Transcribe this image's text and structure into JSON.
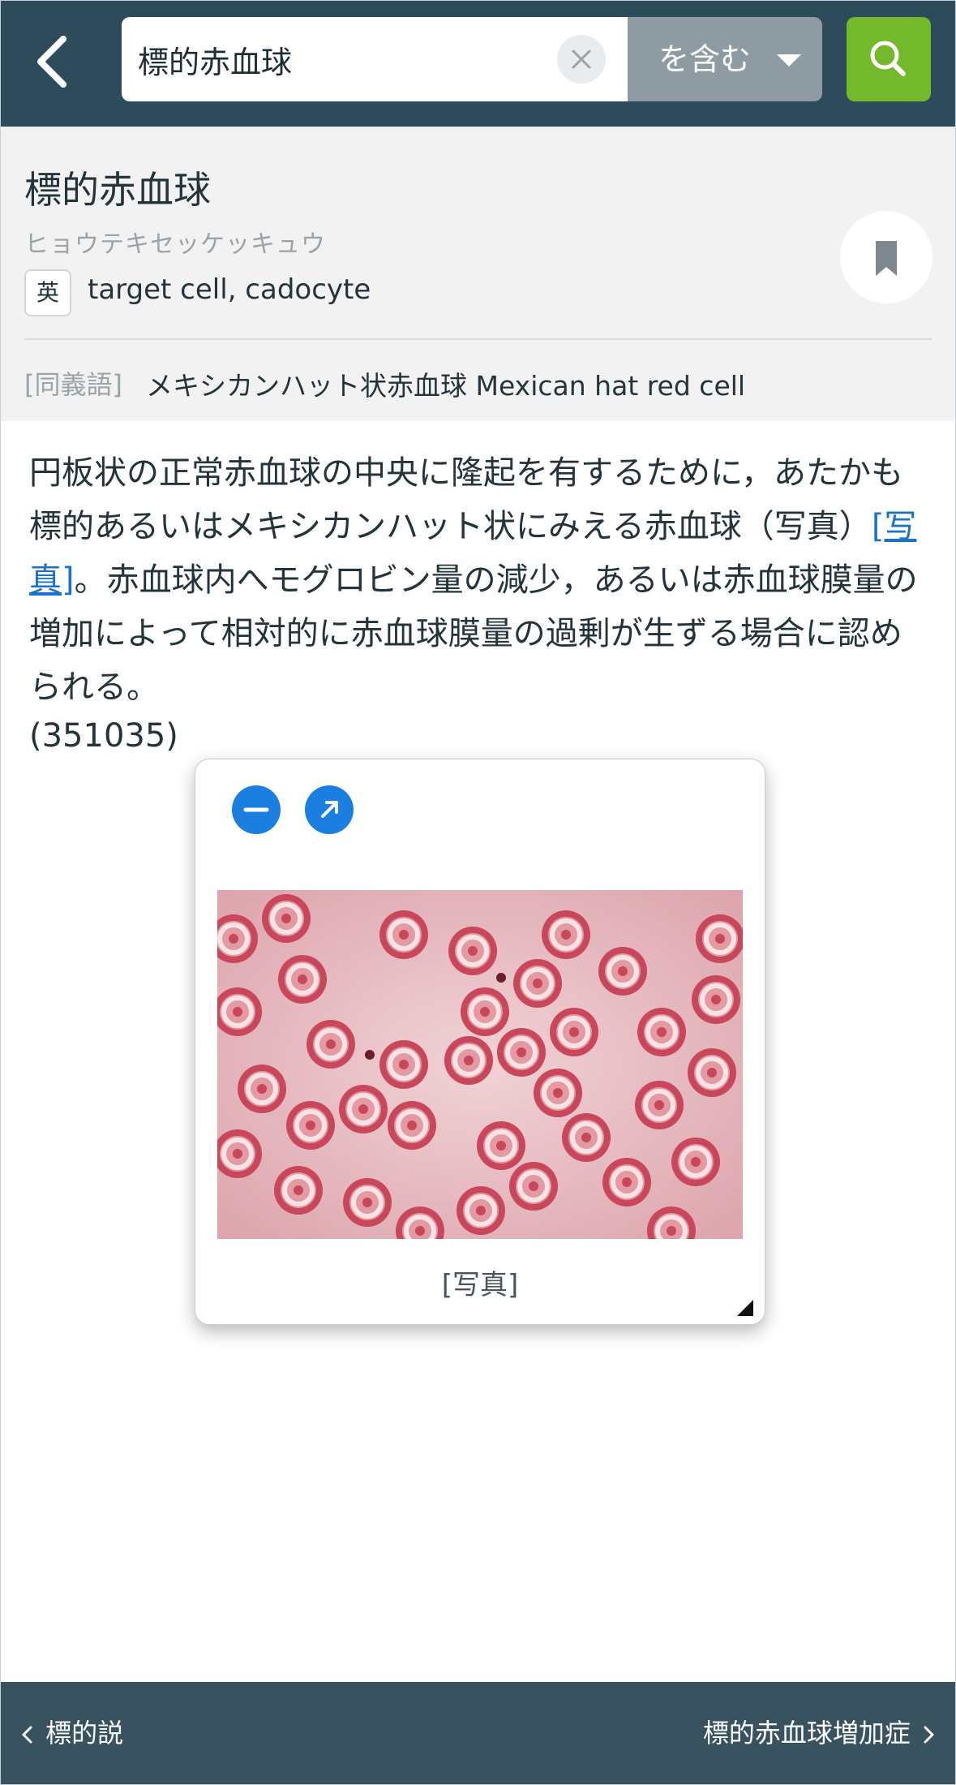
{
  "search": {
    "query": "標的赤血球",
    "mode": "を含む",
    "icons": {
      "back": "chevron-left-icon",
      "clear": "close-icon",
      "caret": "caret-down-icon",
      "search": "search-icon"
    }
  },
  "entry": {
    "term": "標的赤血球",
    "reading": "ヒョウテキセッケッキュウ",
    "en_badge": "英",
    "english": "target cell, cadocyte",
    "synonym_label": "[同義語]",
    "synonym": "メキシカンハット状赤血球 Mexican hat red cell"
  },
  "body": {
    "text_before_link": "円板状の正常赤血球の中央に隆起を有するために，あたかも標的あるいはメキシカンハット状にみえる赤血球（写真）",
    "photo_link": "[写真]",
    "text_after_link": "。赤血球内へモグロビン量の減少，あるいは赤血球膜量の増加によって相対的に赤血球膜量の過剰が生ずる場合に認められる。",
    "code": "(351035)"
  },
  "popup": {
    "caption": "[写真]",
    "icons": [
      "minimize-icon",
      "expand-arrow-icon"
    ]
  },
  "navigation": {
    "prev": "標的説",
    "next": "標的赤血球増加症"
  },
  "colors": {
    "topbar": "#2d4b5b",
    "search_button": "#74b82c",
    "mode_select": "#8f9ba3",
    "link": "#1a73c8",
    "popup_button": "#1a7fe0",
    "bottombar": "#38525f"
  }
}
